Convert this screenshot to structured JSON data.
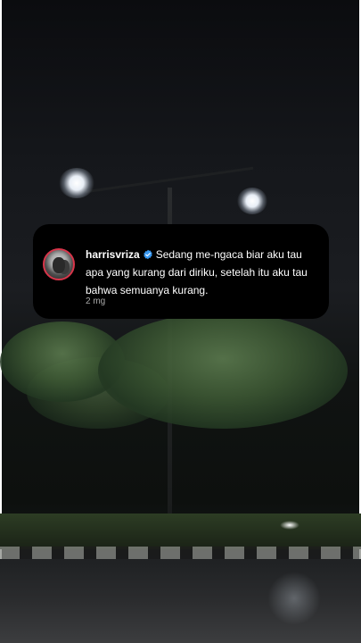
{
  "comment": {
    "username": "harrisvriza",
    "verified_icon": "verified-badge-icon",
    "text": "Sedang me-ngaca biar aku tau apa yang kurang dari diriku, setelah itu aku tau bahwa semuanya kurang.",
    "timestamp": "2 mg"
  },
  "colors": {
    "card_background": "#000000",
    "verified_blue": "#3797f0",
    "avatar_ring": "#d8354a",
    "timestamp": "#a8a8a8"
  }
}
